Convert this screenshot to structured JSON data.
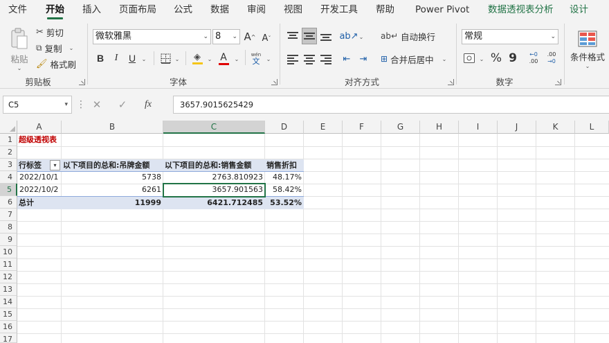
{
  "ribbon_tabs": [
    "文件",
    "开始",
    "插入",
    "页面布局",
    "公式",
    "数据",
    "审阅",
    "视图",
    "开发工具",
    "帮助",
    "Power Pivot",
    "数据透视表分析",
    "设计"
  ],
  "active_tab": "开始",
  "clipboard": {
    "paste": "粘贴",
    "cut": "剪切",
    "copy": "复制",
    "format_painter": "格式刷",
    "group_label": "剪贴板"
  },
  "font": {
    "name": "微软雅黑",
    "size": "8",
    "grow": "A",
    "shrink": "A",
    "bold": "B",
    "italic": "I",
    "underline": "U",
    "font_color_glyph": "A",
    "phonetic_top": "wén",
    "phonetic_bottom": "文",
    "group_label": "字体"
  },
  "alignment": {
    "wrap_text": "自动换行",
    "merge_center": "合并后居中",
    "group_label": "对齐方式"
  },
  "number": {
    "format": "常规",
    "percent": "%",
    "comma": "9",
    "inc_decimal_top": "←0",
    "inc_decimal_bottom": ".00",
    "dec_decimal_top": ".00",
    "dec_decimal_bottom": "→0",
    "group_label": "数字"
  },
  "styles": {
    "conditional_format": "条件格式"
  },
  "formula_bar": {
    "name_box": "C5",
    "cancel": "✕",
    "enter": "✓",
    "fx": "fx",
    "formula": "3657.9015625429"
  },
  "columns": [
    "A",
    "B",
    "C",
    "D",
    "E",
    "F",
    "G",
    "H",
    "I",
    "J",
    "K",
    "L"
  ],
  "rows": [
    "1",
    "2",
    "3",
    "4",
    "5",
    "6",
    "7",
    "8",
    "9",
    "10",
    "11",
    "12",
    "13",
    "14",
    "15",
    "16",
    "17"
  ],
  "sheet": {
    "title": "超级透视表",
    "headers": [
      "行标签",
      "以下项目的总和:吊牌金额",
      "以下项目的总和:销售金额",
      "销售折扣"
    ],
    "filter_glyph": "▾",
    "data_rows": [
      [
        "2022/10/1",
        "5738",
        "2763.810923",
        "48.17%"
      ],
      [
        "2022/10/2",
        "6261",
        "3657.901563",
        "58.42%"
      ]
    ],
    "total_row": [
      "总计",
      "11999",
      "6421.712485",
      "53.52%"
    ]
  },
  "colors": {
    "accent": "#217346",
    "title_red": "#c00000",
    "pivot_band": "#dde4f1",
    "pivot_line": "#8ea9db"
  }
}
